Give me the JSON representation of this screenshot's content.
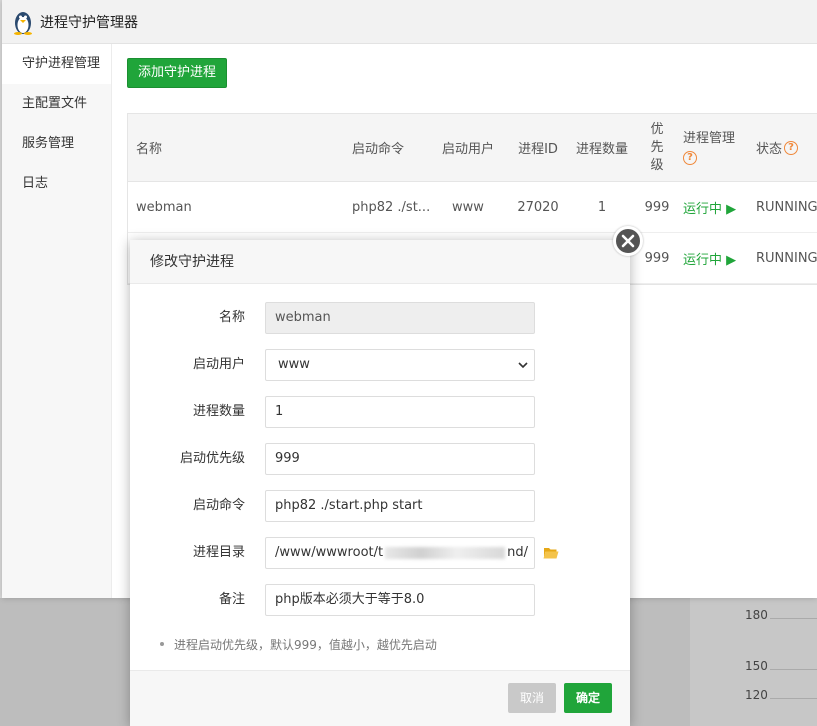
{
  "window": {
    "title": "进程守护管理器"
  },
  "sidebar": {
    "items": [
      {
        "label": "守护进程管理"
      },
      {
        "label": "主配置文件"
      },
      {
        "label": "服务管理"
      },
      {
        "label": "日志"
      }
    ]
  },
  "toolbar": {
    "add_label": "添加守护进程"
  },
  "table": {
    "headers": {
      "name": "名称",
      "cmd": "启动命令",
      "user": "启动用户",
      "pid": "进程ID",
      "num": "进程数量",
      "priority": "优先级",
      "manager": "进程管理",
      "state": "状态"
    },
    "rows": [
      {
        "name": "webman",
        "cmd": "php82 ./st...",
        "user": "www",
        "pid": "27020",
        "num": "1",
        "priority": "999",
        "manager": "运行中 ▶",
        "state": "RUNNING"
      },
      {
        "name": "",
        "cmd": "",
        "user": "",
        "pid": "",
        "num": "",
        "priority": "999",
        "manager": "运行中 ▶",
        "state": "RUNNING"
      }
    ]
  },
  "dialog": {
    "title": "修改守护进程",
    "fields": {
      "name": {
        "label": "名称",
        "value": "webman"
      },
      "user": {
        "label": "启动用户",
        "value": "www"
      },
      "num": {
        "label": "进程数量",
        "value": "1"
      },
      "priority": {
        "label": "启动优先级",
        "value": "999"
      },
      "cmd": {
        "label": "启动命令",
        "value": "php82 ./start.php start"
      },
      "dir": {
        "label": "进程目录",
        "value_prefix": "/www/wwwroot/t",
        "value_suffix": "nd/"
      },
      "note": {
        "label": "备注",
        "value": "php版本必须大于等于8.0"
      }
    },
    "hint": "进程启动优先级，默认999，值越小，越优先启动",
    "cancel_label": "取消",
    "ok_label": "确定"
  },
  "background": {
    "ticks": [
      "180",
      "150",
      "120"
    ]
  },
  "colors": {
    "accent": "#20a53a",
    "help": "#f0883a"
  }
}
